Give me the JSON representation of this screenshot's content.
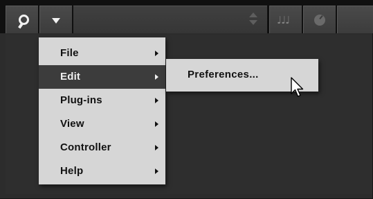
{
  "toolbar": {
    "search_icon": "search-icon",
    "menu_icon": "dropdown-arrow-icon",
    "stepper_icon": "up-down-stepper-icon",
    "notes_icon": "notes-icon",
    "notes_glyph": "♩♩♩",
    "knob_icon": "knob-icon"
  },
  "menu": {
    "items": [
      {
        "label": "File",
        "has_submenu": true
      },
      {
        "label": "Edit",
        "has_submenu": true,
        "active": true
      },
      {
        "label": "Plug-ins",
        "has_submenu": true
      },
      {
        "label": "View",
        "has_submenu": true
      },
      {
        "label": "Controller",
        "has_submenu": true
      },
      {
        "label": "Help",
        "has_submenu": true
      }
    ]
  },
  "submenu": {
    "items": [
      {
        "label": "Preferences..."
      }
    ]
  },
  "colors": {
    "background": "#2c2c2c",
    "toolbar": "#101010",
    "menu_bg": "#d6d6d6",
    "menu_active": "#3c3c3c"
  }
}
